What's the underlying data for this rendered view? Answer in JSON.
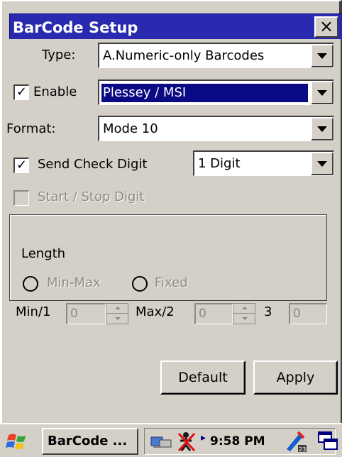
{
  "window": {
    "title": "BarCode Setup",
    "close_glyph": "×"
  },
  "form": {
    "type_label": "Type:",
    "type_value": "A.Numeric-only Barcodes",
    "enable_label": "Enable",
    "enable_checked": "✓",
    "symbology_value": "Plessey / MSI",
    "format_label": "Format:",
    "format_value": "Mode 10",
    "send_check_label": "Send Check Digit",
    "send_check_checked": "✓",
    "check_digit_value": "1 Digit",
    "start_stop_label": "Start / Stop Digit"
  },
  "length": {
    "group_label": "Length",
    "minmax_label": "Min-Max",
    "fixed_label": "Fixed",
    "min_label": "Min/1",
    "min_value": "0",
    "max_label": "Max/2",
    "max_value": "0",
    "third_label": "3",
    "third_value": "0"
  },
  "buttons": {
    "default_label": "Default",
    "apply_label": "Apply"
  },
  "taskbar": {
    "task_label": "BarCode ...",
    "clock": "9:58 PM"
  },
  "colors": {
    "title_bar": "#2a2ab0",
    "selection": "#0a0a84",
    "face": "#d4d0c8"
  }
}
